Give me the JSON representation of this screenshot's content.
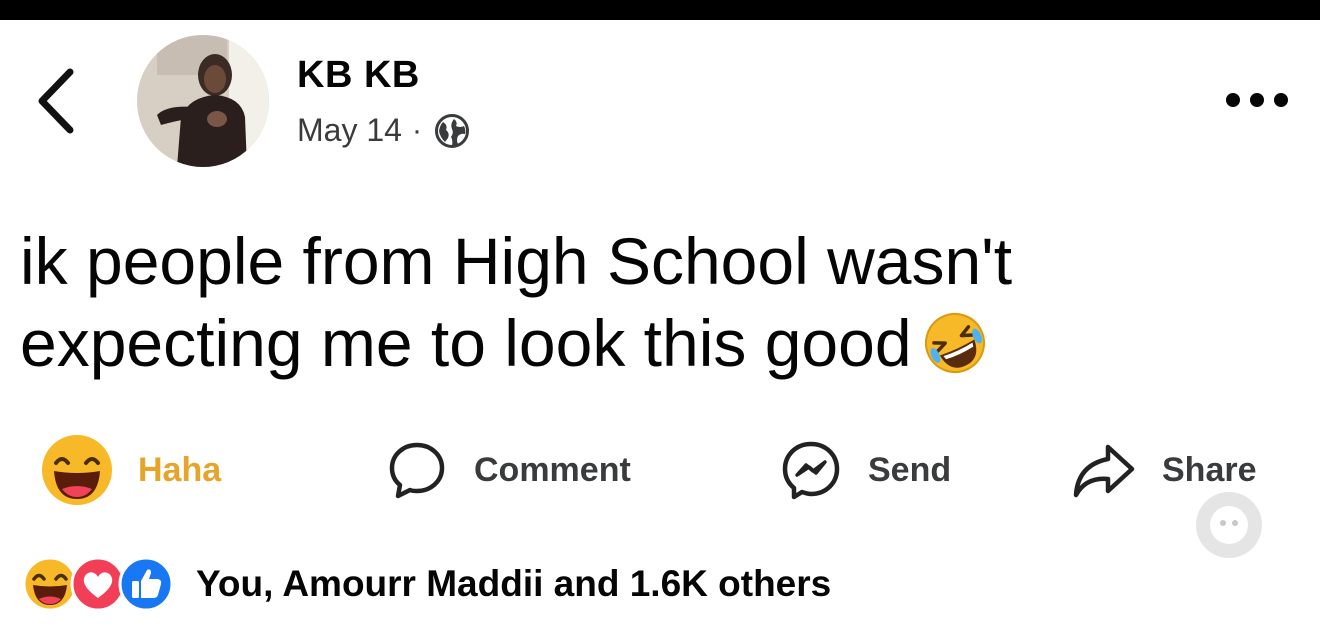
{
  "post": {
    "author": "KB KB",
    "date": "May 14",
    "separator": "·",
    "privacy_icon": "globe-icon",
    "text_line1": "ik people from High School wasn't",
    "text_line2": "expecting me to look this good",
    "emoji": "rolling-on-floor-laughing-emoji"
  },
  "actions": {
    "haha": "Haha",
    "comment": "Comment",
    "send": "Send",
    "share": "Share"
  },
  "reactions": {
    "icons": [
      "haha-reaction-icon",
      "love-reaction-icon",
      "like-reaction-icon"
    ],
    "summary": "You, Amourr Maddii and 1.6K others"
  },
  "colors": {
    "haha_yellow": "#f7b928",
    "haha_label": "#e6a42a",
    "love_red": "#f33e58",
    "like_blue": "#1877f2",
    "text": "#050505"
  }
}
